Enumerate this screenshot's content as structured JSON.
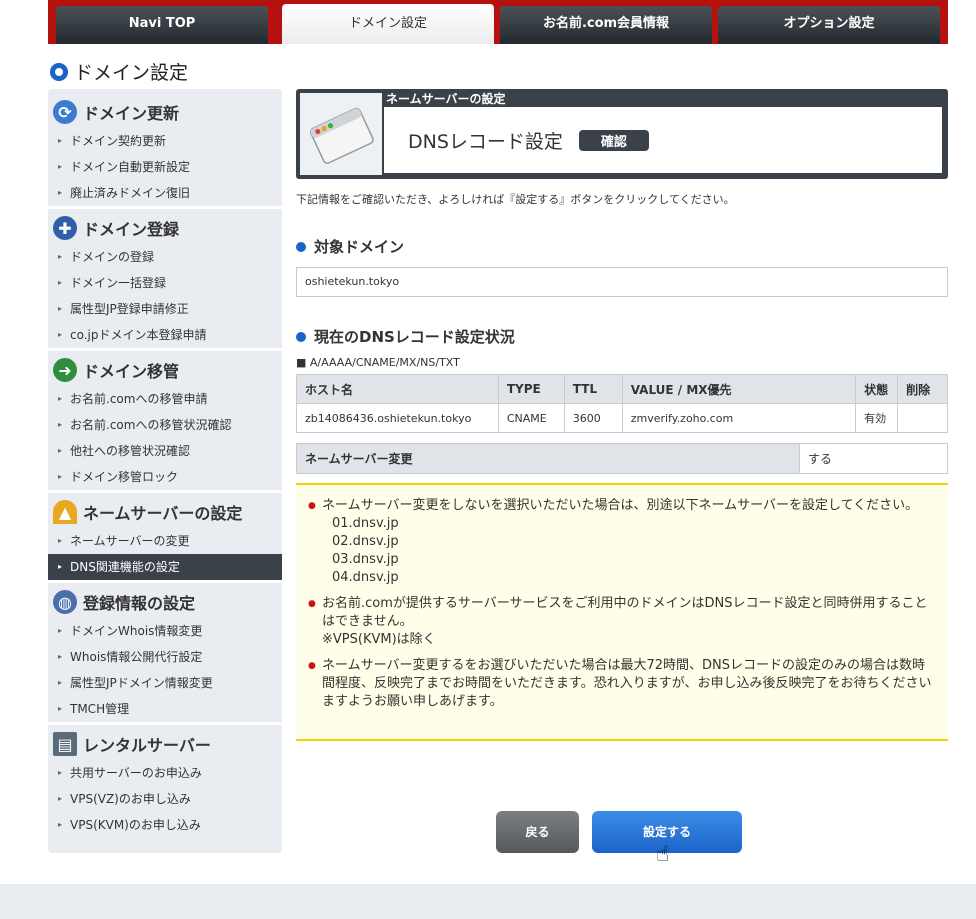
{
  "nav": {
    "tabs": [
      {
        "label": "Navi TOP"
      },
      {
        "label": "ドメイン設定"
      },
      {
        "label": "お名前.com会員情報"
      },
      {
        "label": "オプション設定"
      }
    ]
  },
  "page_title": "ドメイン設定",
  "sidebar": {
    "sections": [
      {
        "title": "ドメイン更新",
        "items": [
          "ドメイン契約更新",
          "ドメイン自動更新設定",
          "廃止済みドメイン復旧"
        ]
      },
      {
        "title": "ドメイン登録",
        "items": [
          "ドメインの登録",
          "ドメイン一括登録",
          "属性型JP登録申請修正",
          "co.jpドメイン本登録申請"
        ]
      },
      {
        "title": "ドメイン移管",
        "items": [
          "お名前.comへの移管申請",
          "お名前.comへの移管状況確認",
          "他社への移管状況確認",
          "ドメイン移管ロック"
        ]
      },
      {
        "title": "ネームサーバーの設定",
        "items": [
          "ネームサーバーの変更",
          "DNS関連機能の設定"
        ]
      },
      {
        "title": "登録情報の設定",
        "items": [
          "ドメインWhois情報変更",
          "Whois情報公開代行設定",
          "属性型JPドメイン情報変更",
          "TMCH管理"
        ]
      },
      {
        "title": "レンタルサーバー",
        "items": [
          "共用サーバーのお申込み",
          "VPS(VZ)のお申し込み",
          "VPS(KVM)のお申し込み"
        ]
      }
    ]
  },
  "header": {
    "subtitle": "ネームサーバーの設定",
    "title": "DNSレコード設定",
    "badge": "確認"
  },
  "description": "下記情報をご確認いただき、よろしければ『設定する』ボタンをクリックしてください。",
  "target_domain": {
    "heading": "対象ドメイン",
    "value": "oshietekun.tokyo"
  },
  "dns_status": {
    "heading": "現在のDNSレコード設定状況",
    "record_types": "■ A/AAAA/CNAME/MX/NS/TXT",
    "columns": [
      "ホスト名",
      "TYPE",
      "TTL",
      "VALUE / MX優先",
      "状態",
      "削除"
    ],
    "rows": [
      [
        "zb14086436.oshietekun.tokyo",
        "CNAME",
        "3600",
        "zmverify.zoho.com",
        "有効",
        ""
      ]
    ]
  },
  "ns_change": {
    "label": "ネームサーバー変更",
    "value": "する"
  },
  "notice": {
    "item1": "ネームサーバー変更をしないを選択いただいた場合は、別途以下ネームサーバーを設定してください。",
    "nameservers": [
      "01.dnsv.jp",
      "02.dnsv.jp",
      "03.dnsv.jp",
      "04.dnsv.jp"
    ],
    "item2": "お名前.comが提供するサーバーサービスをご利用中のドメインはDNSレコード設定と同時併用することはできません。",
    "item2_note": "※VPS(KVM)は除く",
    "item3": "ネームサーバー変更するをお選びいただいた場合は最大72時間、DNSレコードの設定のみの場合は数時間程度、反映完了までお時間をいただきます。恐れ入りますが、お申し込み後反映完了をお待ちくださいますようお願い申しあげます。"
  },
  "buttons": {
    "back": "戻る",
    "submit": "設定する"
  },
  "colors": {
    "nav_bar": "#b5120f",
    "accent_blue": "#1a64c8",
    "dark": "#3a4148"
  }
}
